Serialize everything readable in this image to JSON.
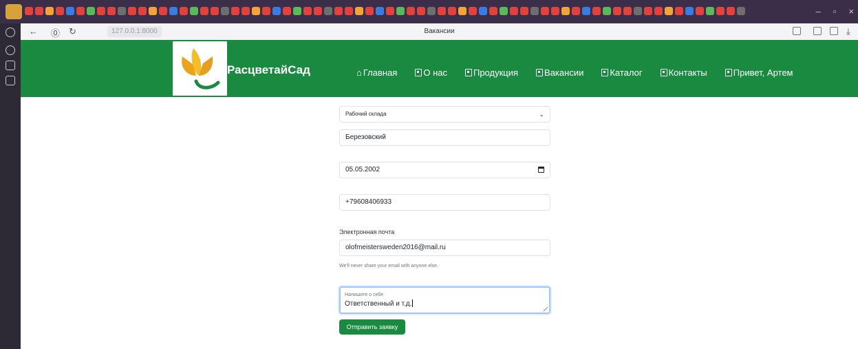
{
  "browser": {
    "url": "127.0.0.1:8000",
    "page_title": "Вакансии"
  },
  "site": {
    "brand": "РасцветайСад",
    "nav": [
      {
        "label": "Главная",
        "icon": "home-icon"
      },
      {
        "label": "О нас",
        "icon": "id-card-icon"
      },
      {
        "label": "Продукция",
        "icon": "contact-card-icon"
      },
      {
        "label": "Вакансии",
        "icon": "contact-card-icon"
      },
      {
        "label": "Каталог",
        "icon": "contact-card-icon"
      },
      {
        "label": "Контакты",
        "icon": "contact-card-icon"
      },
      {
        "label": "Привет, Артем",
        "icon": "contact-card-icon"
      }
    ],
    "accent_color": "#198a3f"
  },
  "form": {
    "position_select": "Рабочий склада",
    "surname": "Березовский",
    "birth_date": "05.05.2002",
    "phone": "+79608406933",
    "email_label": "Электронная почта",
    "email": "olofmeistersweden2016@mail.ru",
    "email_help": "We'll never share your email with anyone else.",
    "about_label": "Напишите о себе",
    "about_value": "Ответственный и т.д.",
    "submit_label": "Отправить заявку"
  }
}
